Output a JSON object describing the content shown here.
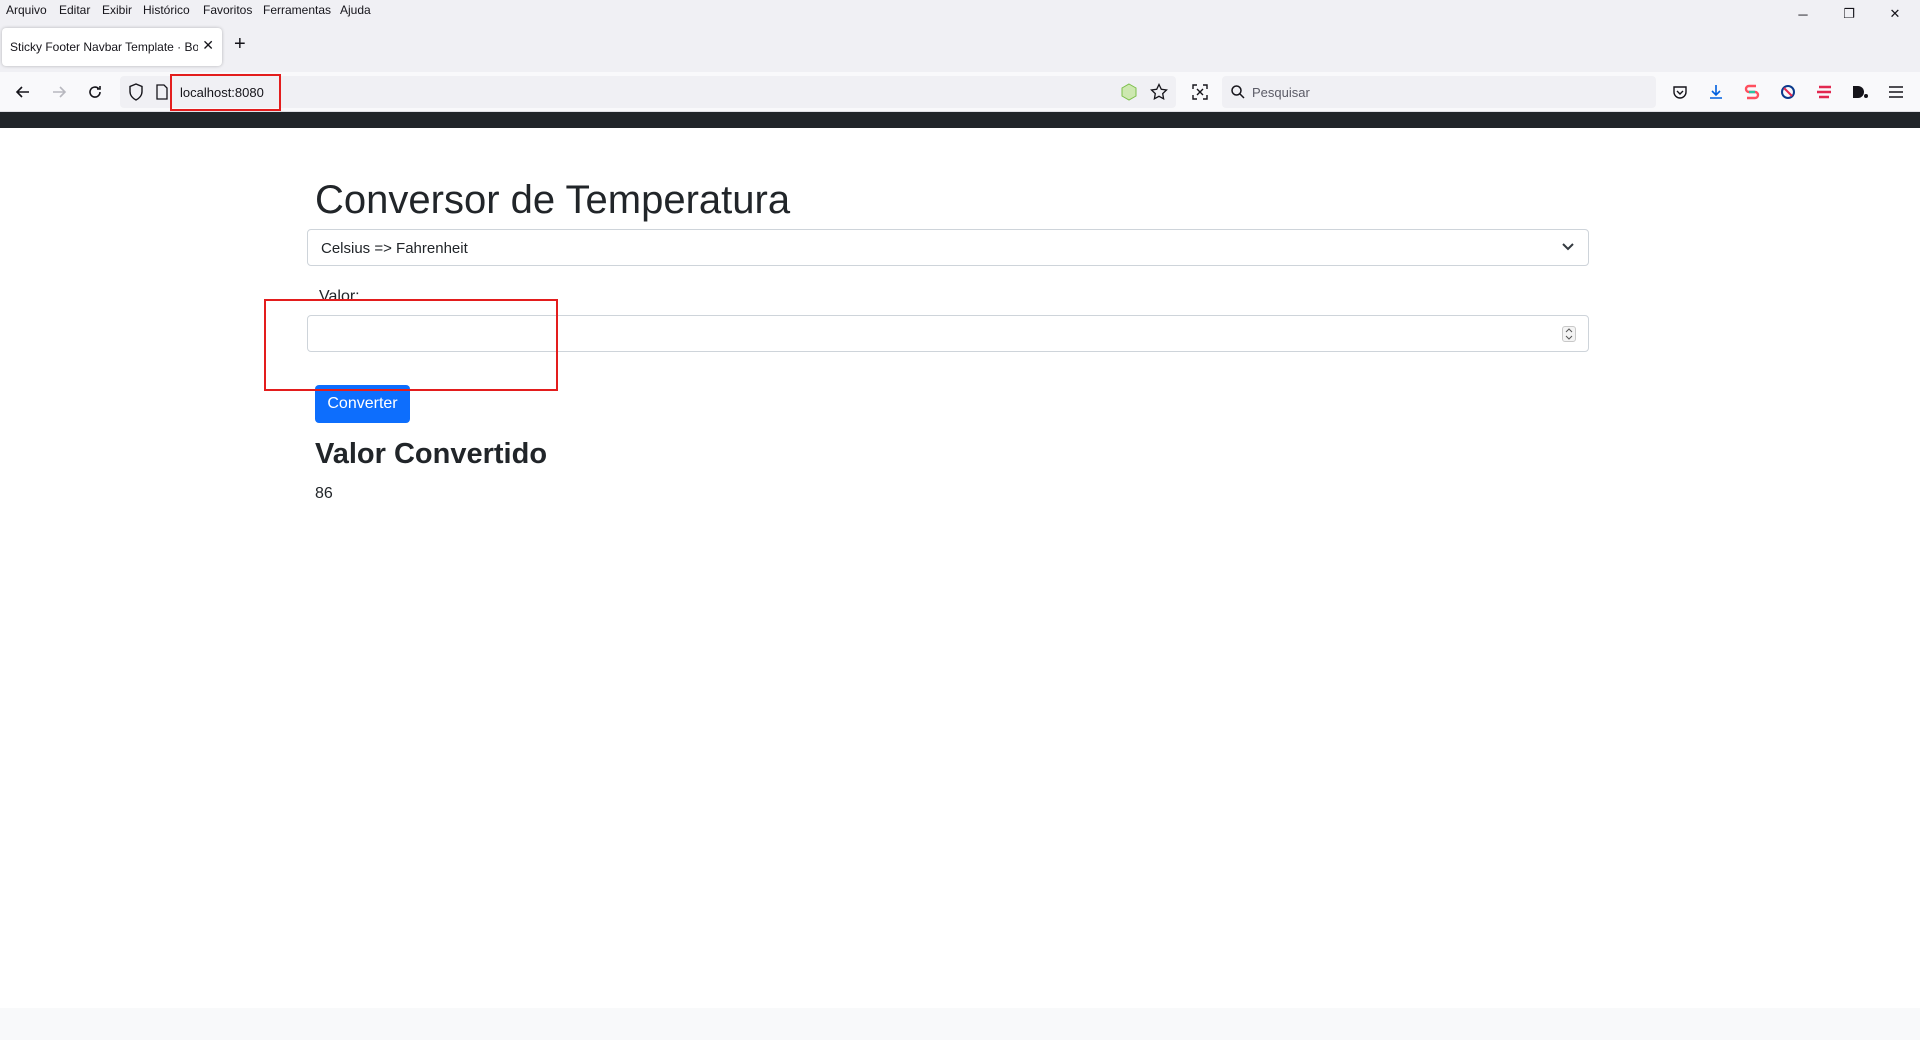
{
  "menu": [
    "Arquivo",
    "Editar",
    "Exibir",
    "Histórico",
    "Favoritos",
    "Ferramentas",
    "Ajuda"
  ],
  "window_controls": {
    "minimize": "─",
    "restore": "❐",
    "close": "✕"
  },
  "tab": {
    "title": "Sticky Footer Navbar Template · Boo",
    "close": "✕",
    "new_tab": "+"
  },
  "toolbar": {
    "url": "localhost:8080",
    "search_placeholder": "Pesquisar",
    "back_icon": "arrow-left-icon",
    "forward_icon": "arrow-right-icon",
    "reload_icon": "reload-icon"
  },
  "page": {
    "title": "Conversor de Temperatura",
    "select_value": "Celsius => Fahrenheit",
    "value_label": "Valor:",
    "value_input": "",
    "convert_button": "Converter",
    "result_title": "Valor Convertido",
    "result_value": "86"
  },
  "colors": {
    "accent": "#0d6efd",
    "highlight": "#e31d1d",
    "topbar": "#212529"
  }
}
